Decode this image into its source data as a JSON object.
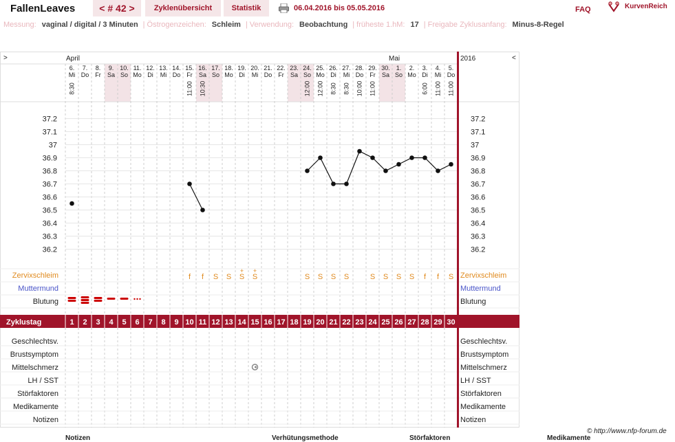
{
  "header": {
    "app_title": "FallenLeaves",
    "cycle_nav": "< # 42 >",
    "tab_overview": "Zyklenübersicht",
    "tab_stats": "Statistik",
    "date_range": "06.04.2016 bis 05.05.2016",
    "faq": "FAQ",
    "brand": "KurvenReich"
  },
  "settings": {
    "items": [
      {
        "label": "Messung:",
        "value": "vaginal / digital / 3 Minuten"
      },
      {
        "label": "Östrogenzeichen:",
        "value": "Schleim"
      },
      {
        "label": "Verwendung:",
        "value": "Beobachtung"
      },
      {
        "label": "früheste 1.hM:",
        "value": "17"
      },
      {
        "label": "Freigabe Zyklusanfang:",
        "value": "Minus-8-Regel"
      }
    ]
  },
  "grid": {
    "expand_left": ">",
    "collapse_right": "<",
    "month_april": "April",
    "month_mai": "Mai",
    "year": "2016",
    "days": [
      {
        "d": "6.",
        "w": "Mi",
        "t": "8:30",
        "we": false
      },
      {
        "d": "7.",
        "w": "Do",
        "t": "",
        "we": false
      },
      {
        "d": "8.",
        "w": "Fr",
        "t": "",
        "we": false
      },
      {
        "d": "9.",
        "w": "Sa",
        "t": "",
        "we": true
      },
      {
        "d": "10.",
        "w": "So",
        "t": "",
        "we": true
      },
      {
        "d": "11.",
        "w": "Mo",
        "t": "",
        "we": false
      },
      {
        "d": "12.",
        "w": "Di",
        "t": "",
        "we": false
      },
      {
        "d": "13.",
        "w": "Mi",
        "t": "",
        "we": false
      },
      {
        "d": "14.",
        "w": "Do",
        "t": "",
        "we": false
      },
      {
        "d": "15.",
        "w": "Fr",
        "t": "11:00",
        "we": false
      },
      {
        "d": "16.",
        "w": "Sa",
        "t": "10:30",
        "we": true
      },
      {
        "d": "17.",
        "w": "So",
        "t": "",
        "we": true
      },
      {
        "d": "18.",
        "w": "Mo",
        "t": "",
        "we": false
      },
      {
        "d": "19.",
        "w": "Di",
        "t": "",
        "we": false
      },
      {
        "d": "20.",
        "w": "Mi",
        "t": "",
        "we": false
      },
      {
        "d": "21.",
        "w": "Do",
        "t": "",
        "we": false
      },
      {
        "d": "22.",
        "w": "Fr",
        "t": "",
        "we": false
      },
      {
        "d": "23.",
        "w": "Sa",
        "t": "",
        "we": true
      },
      {
        "d": "24.",
        "w": "So",
        "t": "12:00",
        "we": true
      },
      {
        "d": "25.",
        "w": "Mo",
        "t": "12:00",
        "we": false
      },
      {
        "d": "26.",
        "w": "Di",
        "t": "8:30",
        "we": false
      },
      {
        "d": "27.",
        "w": "Mi",
        "t": "8:30",
        "we": false
      },
      {
        "d": "28.",
        "w": "Do",
        "t": "10:00",
        "we": false
      },
      {
        "d": "29.",
        "w": "Fr",
        "t": "11:00",
        "we": false
      },
      {
        "d": "30.",
        "w": "Sa",
        "t": "",
        "we": true
      },
      {
        "d": "1.",
        "w": "So",
        "t": "",
        "we": true
      },
      {
        "d": "2.",
        "w": "Mo",
        "t": "",
        "we": false
      },
      {
        "d": "3.",
        "w": "Di",
        "t": "6:00",
        "we": false
      },
      {
        "d": "4.",
        "w": "Mi",
        "t": "11:00",
        "we": false
      },
      {
        "d": "5.",
        "w": "Do",
        "t": "11:00",
        "we": false
      }
    ],
    "temp_ticks": [
      "37.2",
      "37.1",
      "37",
      "36.9",
      "36.8",
      "36.7",
      "36.6",
      "36.5",
      "36.4",
      "36.3",
      "36.2"
    ],
    "temperatures": [
      36.55,
      null,
      null,
      null,
      null,
      null,
      null,
      null,
      null,
      36.7,
      36.5,
      null,
      null,
      null,
      null,
      null,
      null,
      null,
      36.8,
      36.9,
      36.7,
      36.7,
      36.95,
      36.9,
      36.8,
      36.85,
      36.9,
      36.9,
      36.8,
      36.85
    ],
    "temp_segments": [
      [
        0,
        0
      ],
      [
        9,
        10
      ],
      [
        18,
        29
      ]
    ],
    "cervical_mucus": [
      "",
      "",
      "",
      "",
      "",
      "",
      "",
      "",
      "",
      "f",
      "f",
      "S",
      "S",
      "S+",
      "S+",
      "",
      "",
      "",
      "S",
      "S",
      "S",
      "S",
      "",
      "S",
      "S",
      "S",
      "S",
      "f",
      "f",
      "S"
    ],
    "bleeding": [
      3,
      4,
      3,
      2,
      2,
      1,
      0,
      0,
      0,
      0,
      0,
      0,
      0,
      0,
      0,
      0,
      0,
      0,
      0,
      0,
      0,
      0,
      0,
      0,
      0,
      0,
      0,
      0,
      0,
      0
    ],
    "mittelschmerz_day": 15,
    "rows": {
      "zervix": "Zervixschleim",
      "muttermund": "Muttermund",
      "blutung": "Blutung",
      "zyklustag": "Zyklustag",
      "geschlecht": "Geschlechtsv.",
      "brust": "Brustsymptom",
      "mittel": "Mittelschmerz",
      "lh": "LH / SST",
      "stoer": "Störfaktoren",
      "medi": "Medikamente",
      "notizen": "Notizen"
    },
    "colors": {
      "accent": "#a0142a",
      "weekend": "#f3e3e6",
      "mucus": "#e08a1e",
      "muttermund": "#4a55c8",
      "bleeding": "#cc0000"
    }
  },
  "footer": {
    "copyright": "© http://www.nfp-forum.de",
    "notizen": "Notizen",
    "verhuetung": "Verhütungsmethode",
    "stoerfaktoren": "Störfaktoren",
    "medikamente": "Medikamente"
  }
}
